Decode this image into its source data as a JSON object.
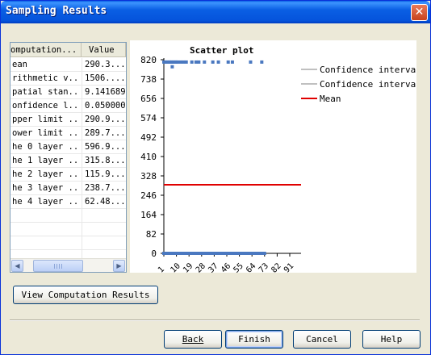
{
  "window": {
    "title": "Sampling Results",
    "close_glyph": "✕"
  },
  "table": {
    "headers": [
      "omputation...",
      "Value"
    ],
    "rows": [
      {
        "name": "ean",
        "value": "290.3..."
      },
      {
        "name": "rithmetic v...",
        "value": "1506...."
      },
      {
        "name": "patial stan...",
        "value": "9.141689"
      },
      {
        "name": "onfidence l...",
        "value": "0.050000"
      },
      {
        "name": "pper limit ...",
        "value": "290.9..."
      },
      {
        "name": "ower limit ...",
        "value": "289.7..."
      },
      {
        "name": "he 0 layer ...",
        "value": "596.9..."
      },
      {
        "name": "he 1 layer ...",
        "value": "315.8..."
      },
      {
        "name": "he 2 layer ...",
        "value": "115.9..."
      },
      {
        "name": "he 3 layer ...",
        "value": "238.7..."
      },
      {
        "name": "he 4 layer ...",
        "value": "62.48..."
      }
    ]
  },
  "chart": {
    "title": "Scatter plot",
    "y_ticks": [
      "820",
      "738",
      "656",
      "574",
      "492",
      "410",
      "328",
      "246",
      "164",
      "82",
      "0"
    ],
    "x_ticks": [
      "1",
      "10",
      "19",
      "28",
      "37",
      "46",
      "55",
      "64",
      "73",
      "82",
      "91"
    ],
    "legend": [
      {
        "label": "Confidence interval",
        "color": "#c0c0c0"
      },
      {
        "label": "Confidence interval",
        "color": "#c0c0c0"
      },
      {
        "label": "Mean",
        "color": "#e00000"
      }
    ]
  },
  "chart_data": {
    "type": "scatter",
    "title": "Scatter plot",
    "xlabel": "",
    "ylabel": "",
    "xlim": [
      1,
      91
    ],
    "ylim": [
      0,
      820
    ],
    "x_ticks": [
      1,
      10,
      19,
      28,
      37,
      46,
      55,
      64,
      73,
      82,
      91
    ],
    "y_ticks": [
      0,
      82,
      164,
      246,
      328,
      410,
      492,
      574,
      656,
      738,
      820
    ],
    "legend_position": "right",
    "grid": false,
    "series": [
      {
        "name": "Confidence interval",
        "type": "line",
        "color": "#c0c0c0",
        "x": [
          1,
          73
        ],
        "y": [
          291,
          291
        ]
      },
      {
        "name": "Confidence interval",
        "type": "line",
        "color": "#c0c0c0",
        "x": [
          1,
          73
        ],
        "y": [
          290,
          290
        ]
      },
      {
        "name": "Mean",
        "type": "line",
        "color": "#e00000",
        "x": [
          1,
          73
        ],
        "y": [
          290.3,
          290.3
        ]
      },
      {
        "type": "scatter",
        "color": "#4a78c0",
        "x": [
          1,
          2,
          3,
          4,
          5,
          6,
          7,
          8,
          9,
          10,
          11,
          13,
          15,
          17,
          21,
          24,
          26,
          30,
          36,
          40,
          47,
          50,
          63,
          71,
          1,
          2,
          3,
          4,
          5,
          7,
          8,
          10,
          12,
          14,
          15,
          16,
          17,
          18,
          19,
          20,
          21,
          22,
          23,
          24,
          25,
          26,
          27,
          28,
          29,
          30,
          31,
          32,
          33,
          34,
          35,
          36,
          37,
          38,
          39,
          40,
          41,
          42,
          43,
          44,
          45,
          46,
          47,
          48,
          49,
          50,
          51,
          52,
          53,
          54,
          55,
          56,
          57,
          58,
          59,
          60,
          61,
          62,
          63,
          64,
          65,
          66,
          67,
          68,
          69,
          70,
          71,
          72,
          73,
          7
        ],
        "y": [
          810,
          810,
          810,
          810,
          810,
          810,
          810,
          810,
          810,
          810,
          810,
          810,
          810,
          810,
          810,
          810,
          810,
          810,
          810,
          810,
          810,
          810,
          810,
          810,
          0,
          0,
          0,
          0,
          0,
          0,
          0,
          0,
          0,
          0,
          0,
          0,
          0,
          0,
          0,
          0,
          0,
          0,
          0,
          0,
          0,
          0,
          0,
          0,
          0,
          0,
          0,
          0,
          0,
          0,
          0,
          0,
          0,
          0,
          0,
          0,
          0,
          0,
          0,
          0,
          0,
          0,
          0,
          0,
          0,
          0,
          0,
          0,
          0,
          0,
          0,
          0,
          0,
          0,
          0,
          0,
          0,
          0,
          0,
          0,
          0,
          0,
          0,
          0,
          0,
          0,
          0,
          0,
          0,
          790
        ]
      }
    ]
  },
  "buttons": {
    "view": "View Computation Results",
    "back": "Back",
    "finish": "Finish",
    "cancel": "Cancel",
    "help": "Help"
  },
  "scrollbar": {
    "left_glyph": "◀",
    "right_glyph": "▶"
  }
}
